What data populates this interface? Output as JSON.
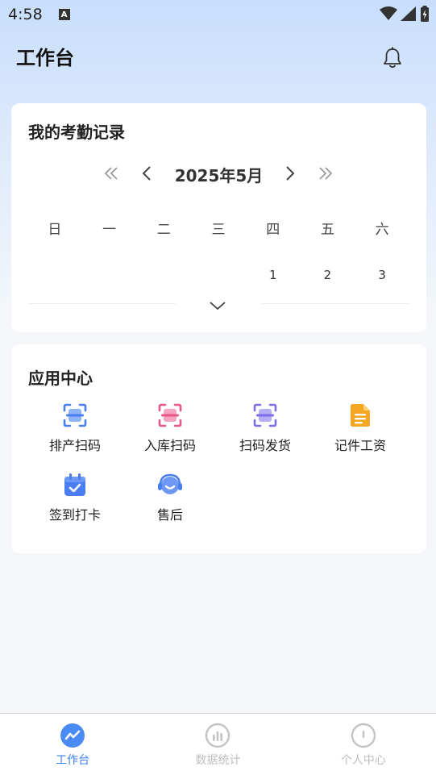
{
  "status_bar": {
    "time": "4:58",
    "notif_letter": "A"
  },
  "header": {
    "title": "工作台",
    "bell_icon": "bell-icon"
  },
  "attendance": {
    "title": "我的考勤记录",
    "month_label": "2025年5月",
    "weekdays": [
      "日",
      "一",
      "二",
      "三",
      "四",
      "五",
      "六"
    ],
    "week_row": [
      "",
      "",
      "",
      "",
      "1",
      "2",
      "3"
    ]
  },
  "app_center": {
    "title": "应用中心",
    "apps": [
      {
        "label": "排产扫码",
        "icon": "scan-icon",
        "color": "#4a7df0"
      },
      {
        "label": "入库扫码",
        "icon": "scan-icon",
        "color": "#e8578a"
      },
      {
        "label": "扫码发货",
        "icon": "scan-icon",
        "color": "#7b6ee8"
      },
      {
        "label": "记件工资",
        "icon": "document-icon",
        "color": "#f5a623"
      },
      {
        "label": "签到打卡",
        "icon": "calendar-check-icon",
        "color": "#4a7df0"
      },
      {
        "label": "售后",
        "icon": "headset-icon",
        "color": "#4a7df0"
      }
    ]
  },
  "tabbar": {
    "tabs": [
      {
        "label": "工作台",
        "icon": "trend-icon",
        "active": true
      },
      {
        "label": "数据统计",
        "icon": "bar-chart-icon",
        "active": false
      },
      {
        "label": "个人中心",
        "icon": "person-icon",
        "active": false
      }
    ],
    "active_color": "#3b82f6",
    "inactive_color": "#bdbdbd"
  }
}
